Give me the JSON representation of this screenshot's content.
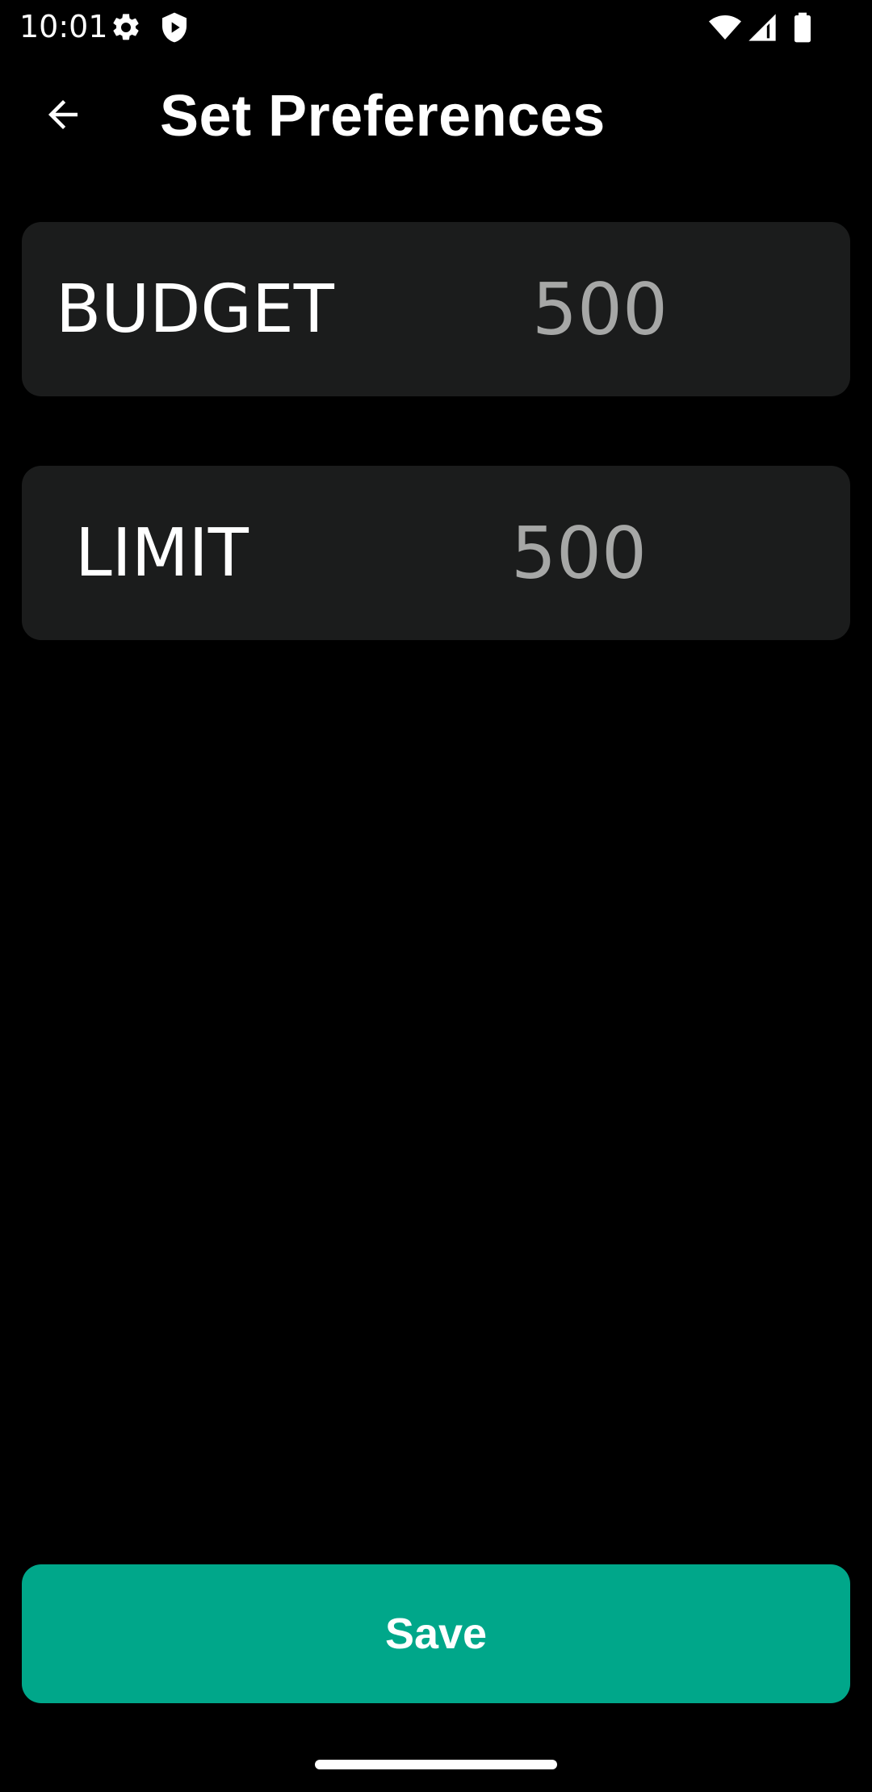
{
  "status_bar": {
    "time": "10:01",
    "icons": [
      "gear-icon",
      "shield-play-icon",
      "wifi-icon",
      "cellular-signal-icon",
      "battery-icon"
    ]
  },
  "app_bar": {
    "back_icon": "arrow-left-icon",
    "title": "Set Preferences"
  },
  "preferences": [
    {
      "label": "BUDGET",
      "value": "500"
    },
    {
      "label": "LIMIT",
      "value": "500"
    }
  ],
  "save_label": "Save",
  "colors": {
    "background": "#000000",
    "card": "#1b1c1c",
    "value_text": "#a6a7a6",
    "accent": "#00a78a",
    "text": "#ffffff"
  }
}
